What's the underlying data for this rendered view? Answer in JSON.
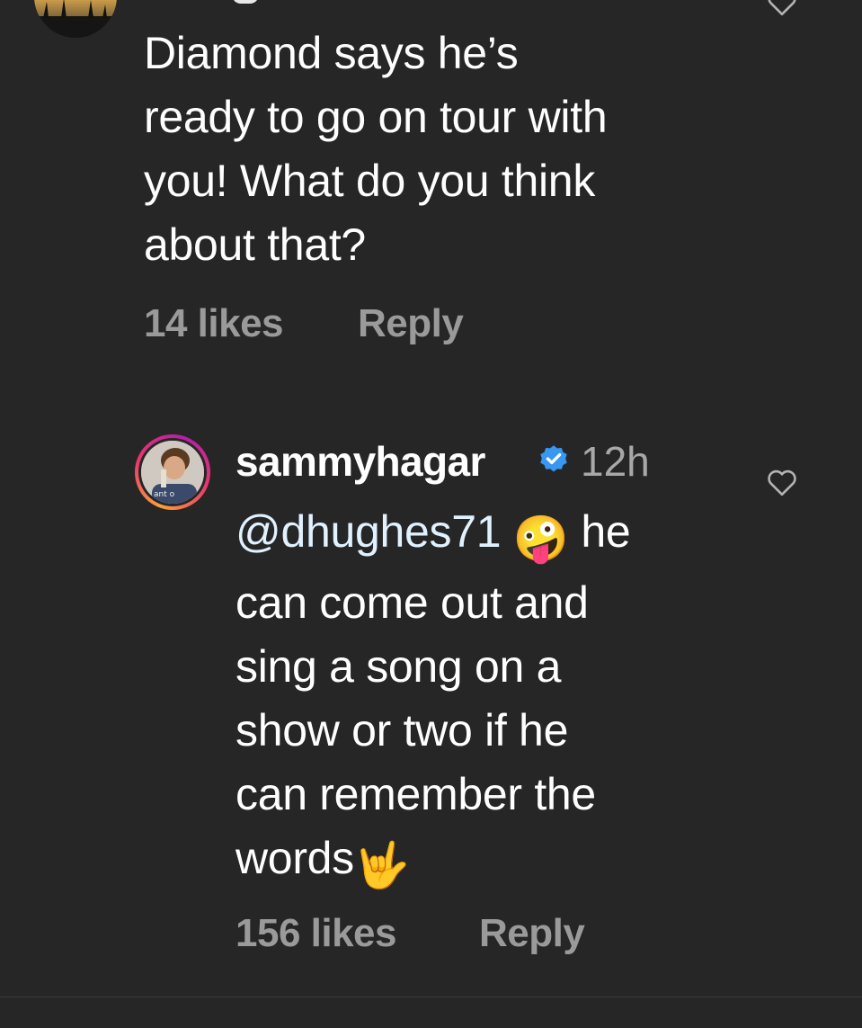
{
  "parent_comment": {
    "text": "Diamond says he’s\nready to go on tour with\nyou!  What do you think\nabout that?",
    "likes": "14 likes",
    "reply_label": "Reply"
  },
  "reply_comment": {
    "username": "sammyhagar",
    "verified_icon": "verified-badge-icon",
    "timestamp": "12h",
    "mention": "@dhughes71",
    "emoji_1": "🤪",
    "text_after_emoji": " he\ncan come out and\nsing a song on a\nshow or two if he\ncan remember the\nwords",
    "emoji_2": "🤟",
    "likes": "156 likes",
    "reply_label": "Reply"
  },
  "colors": {
    "background": "#262626",
    "text": "#ffffff",
    "muted": "#9a9a9a",
    "verified": "#3897f0"
  }
}
